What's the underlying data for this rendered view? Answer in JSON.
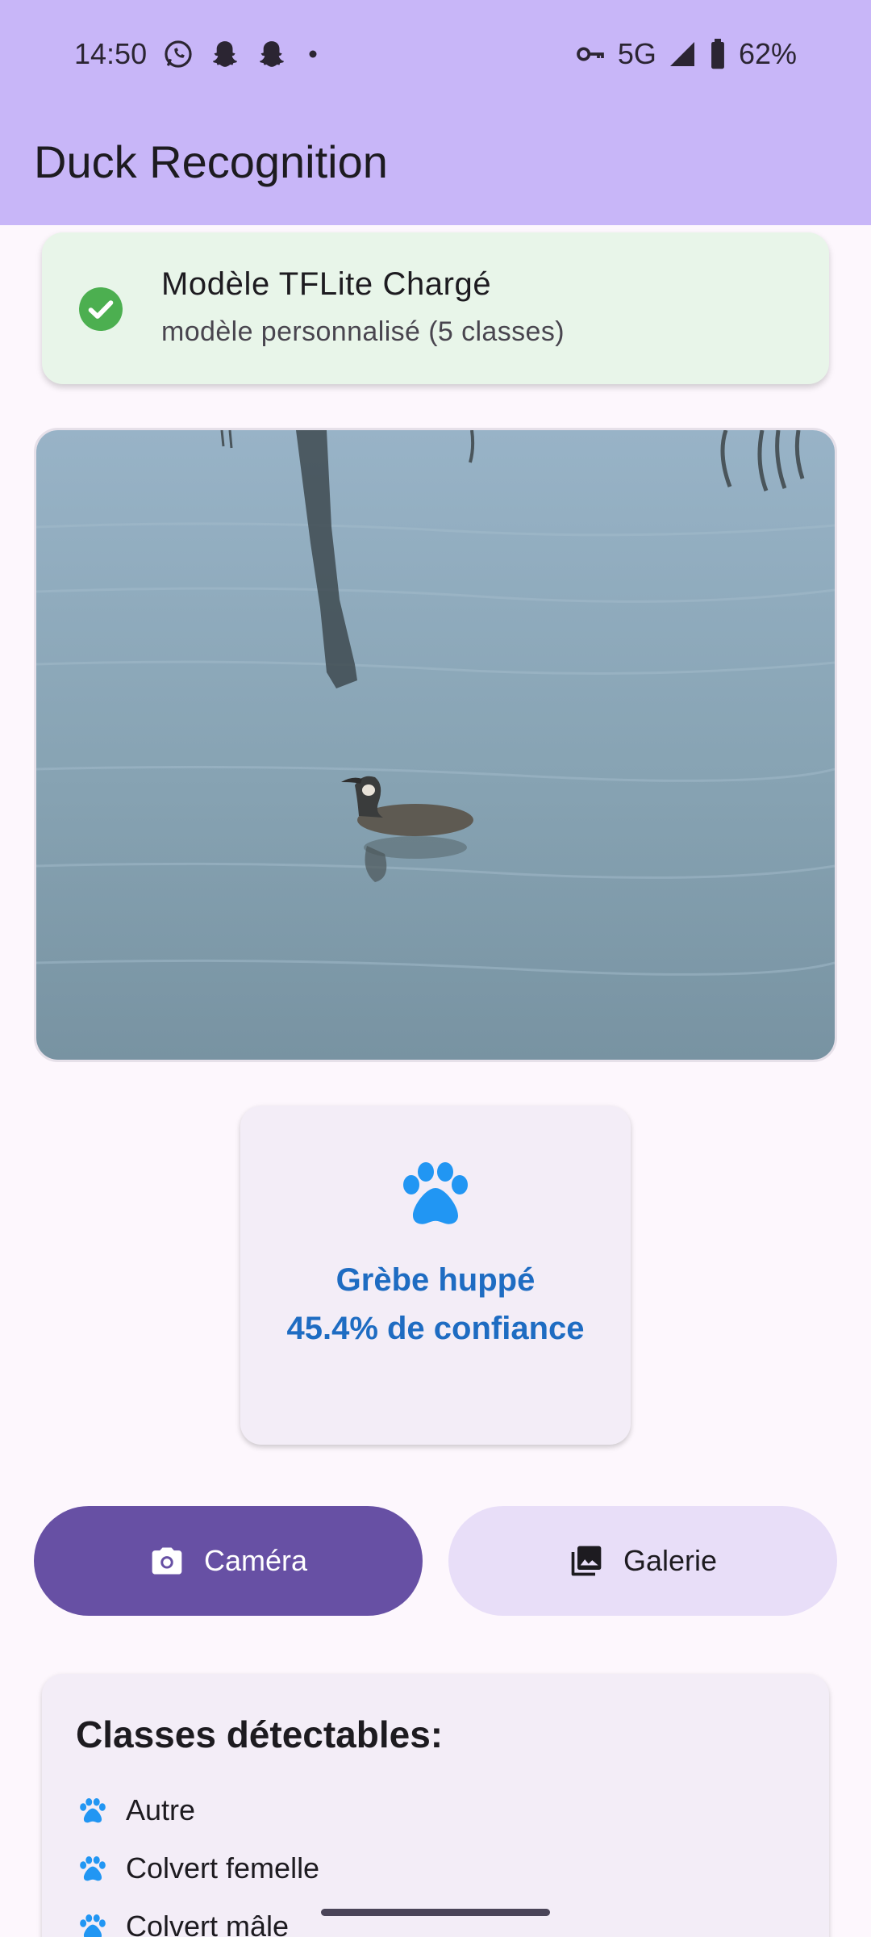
{
  "status_bar": {
    "time": "14:50",
    "network": "5G",
    "battery": "62%",
    "icons": [
      "whatsapp-icon",
      "snapchat-icon",
      "snapchat-icon",
      "dot-icon",
      "vpn-key-icon",
      "signal-icon",
      "battery-icon"
    ]
  },
  "app_bar": {
    "title": "Duck Recognition"
  },
  "model_status": {
    "title": "Modèle TFLite Chargé",
    "subtitle": "modèle personnalisé (5 classes)",
    "icon": "check-circle-icon",
    "color": "#4caf50"
  },
  "photo": {
    "description_icon": "grebe-on-water-photo"
  },
  "result": {
    "icon": "paw-icon",
    "species": "Grèbe huppé",
    "confidence": "45.4% de confiance",
    "color": "#1e6cc2"
  },
  "actions": {
    "camera_label": "Caméra",
    "gallery_label": "Galerie",
    "camera_icon": "camera-icon",
    "gallery_icon": "photo-library-icon"
  },
  "classes": {
    "heading": "Classes détectables:",
    "items": [
      "Autre",
      "Colvert femelle",
      "Colvert mâle"
    ]
  },
  "colors": {
    "app_bar": "#c8b6f8",
    "primary": "#6750a4",
    "secondary_container": "#e8def8",
    "accent_blue": "#2196f3"
  }
}
